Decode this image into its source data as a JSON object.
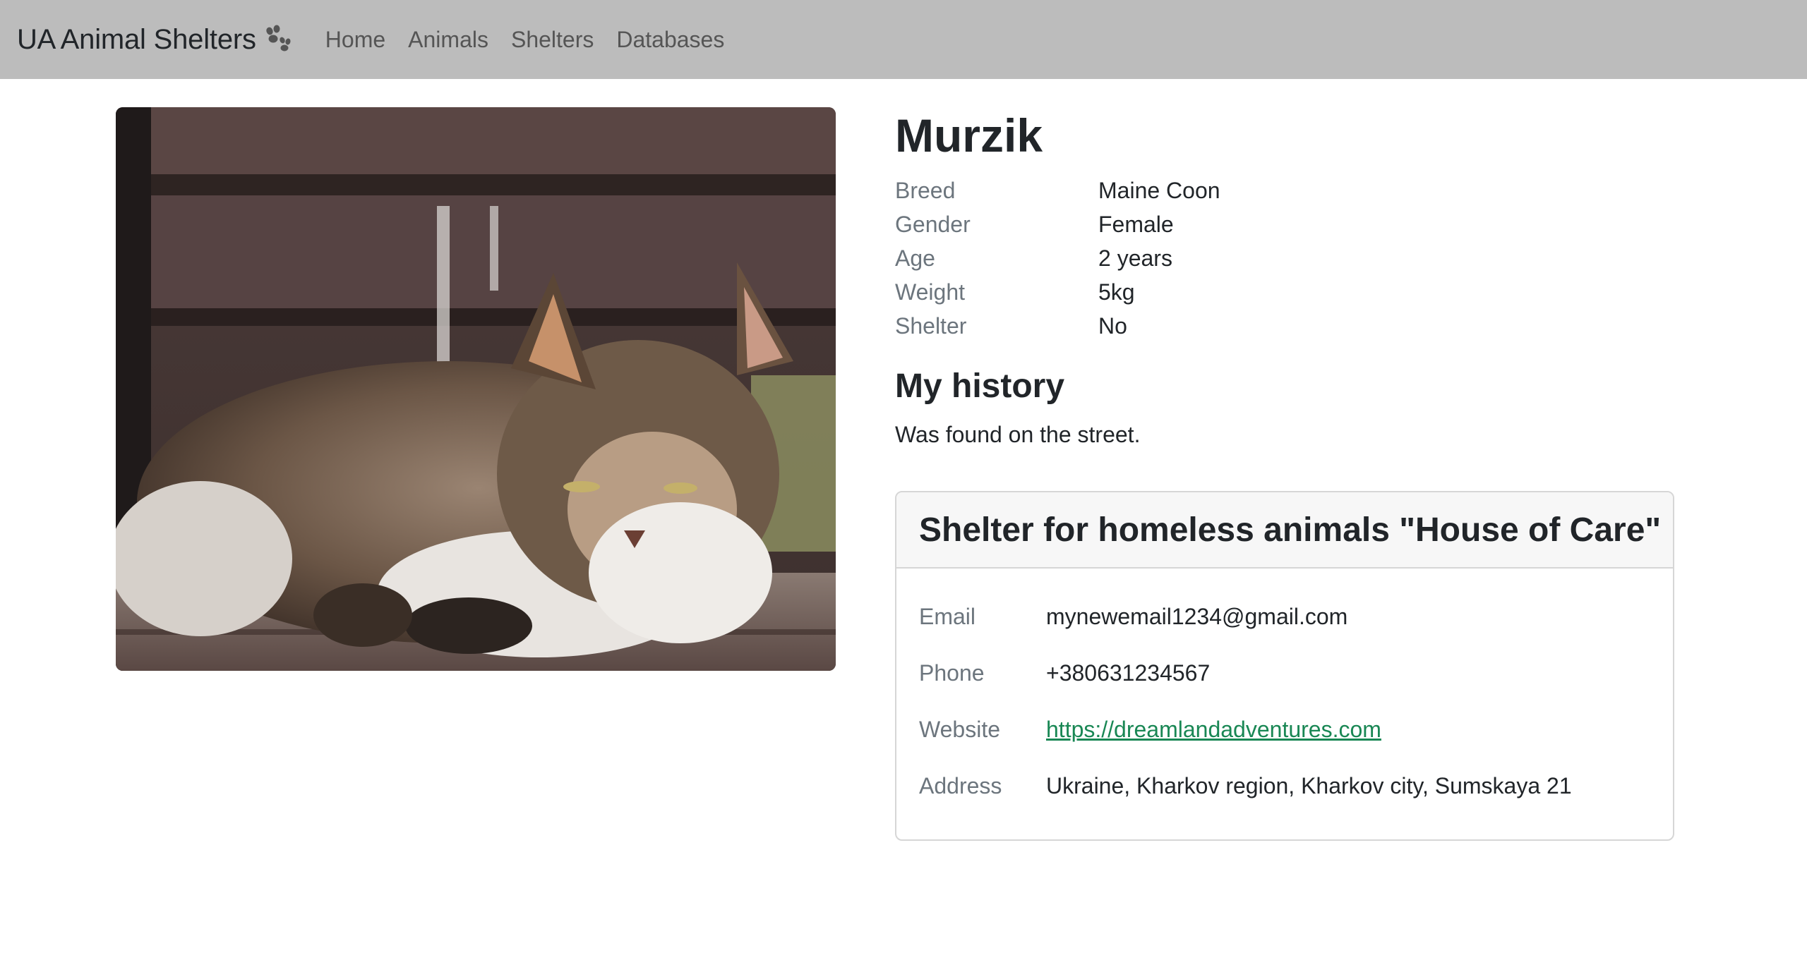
{
  "navbar": {
    "brand": "UA Animal Shelters",
    "brand_icon": "paw-icon",
    "links": [
      "Home",
      "Animals",
      "Shelters",
      "Databases"
    ]
  },
  "animal": {
    "photo_alt": "cat-photo",
    "name": "Murzik",
    "attributes": [
      {
        "label": "Breed",
        "value": "Maine Coon"
      },
      {
        "label": "Gender",
        "value": "Female"
      },
      {
        "label": "Age",
        "value": "2 years"
      },
      {
        "label": "Weight",
        "value": "5kg"
      },
      {
        "label": "Shelter",
        "value": "No"
      }
    ],
    "history_title": "My history",
    "history_text": "Was found on the street."
  },
  "shelter": {
    "title": "Shelter for homeless animals \"House of Care\"",
    "rows": [
      {
        "label": "Email",
        "value": "mynewemail1234@gmail.com"
      },
      {
        "label": "Phone",
        "value": "+380631234567"
      },
      {
        "label": "Website",
        "value": "https://dreamlandadventures.com"
      },
      {
        "label": "Address",
        "value": "Ukraine, Kharkov region, Kharkov city, Sumskaya 21"
      }
    ]
  },
  "colors": {
    "navbar_bg": "#bcbcbc",
    "link_green": "#198754",
    "muted_label": "#6c757d"
  }
}
